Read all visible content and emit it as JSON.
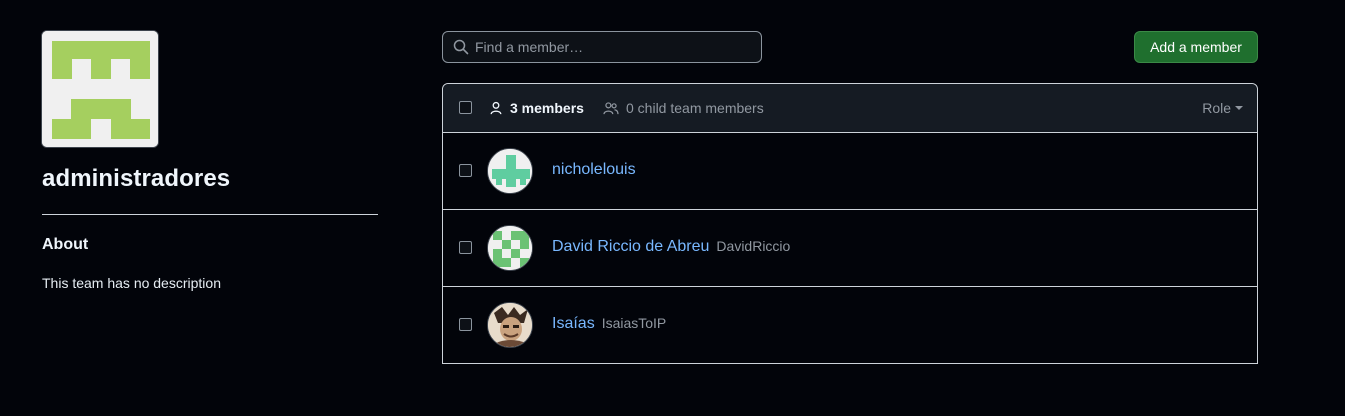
{
  "team": {
    "name": "administradores",
    "about_heading": "About",
    "about_text": "This team has no description",
    "avatar_color": "#a5cf5f"
  },
  "search": {
    "placeholder": "Find a member…",
    "value": ""
  },
  "actions": {
    "add_member_label": "Add a member"
  },
  "table": {
    "members_label": "3 members",
    "child_members_label": "0 child team members",
    "role_filter_label": "Role",
    "members": [
      {
        "name": "nicholelouis",
        "login": "",
        "avatar_color": "#5fcda0"
      },
      {
        "name": "David Riccio de Abreu",
        "login": "DavidRiccio",
        "avatar_color": "#6bc274"
      },
      {
        "name": "Isaías",
        "login": "IsaiasToIP",
        "avatar_color": "#8a5a3c"
      }
    ]
  },
  "colors": {
    "background": "#02040a",
    "link": "#79b8ff",
    "primary_button": "#1f6f2e"
  }
}
